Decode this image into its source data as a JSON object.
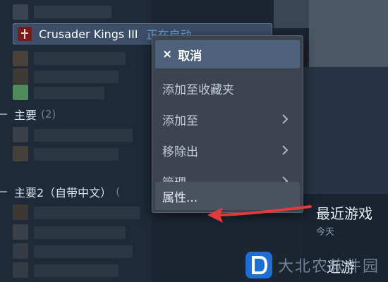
{
  "library": {
    "game": {
      "title": "Crusader Kings III",
      "status": "正在启动...",
      "icon": "cross-emblem-icon"
    },
    "sections": [
      {
        "label": "主要",
        "count": "(2)"
      },
      {
        "label": "主要2（自带中文）",
        "count": "("
      }
    ]
  },
  "context_menu": {
    "items": [
      {
        "label": "取消",
        "prefix": "×",
        "submenu": false
      },
      {
        "label": "添加至收藏夹",
        "submenu": false
      },
      {
        "label": "添加至",
        "submenu": true
      },
      {
        "label": "移除出",
        "submenu": true
      },
      {
        "label": "管理",
        "submenu": true
      },
      {
        "label": "属性...",
        "submenu": false
      }
    ]
  },
  "right_panel": {
    "recent_label": "最近游戏",
    "recent_sub": "今天",
    "recent_label_2": "近游"
  },
  "watermark": {
    "text": "大北农软件园"
  },
  "colors": {
    "accent": "#4d617a",
    "annotation_arrow": "#e03a3a",
    "link_status": "#6ea8de"
  }
}
